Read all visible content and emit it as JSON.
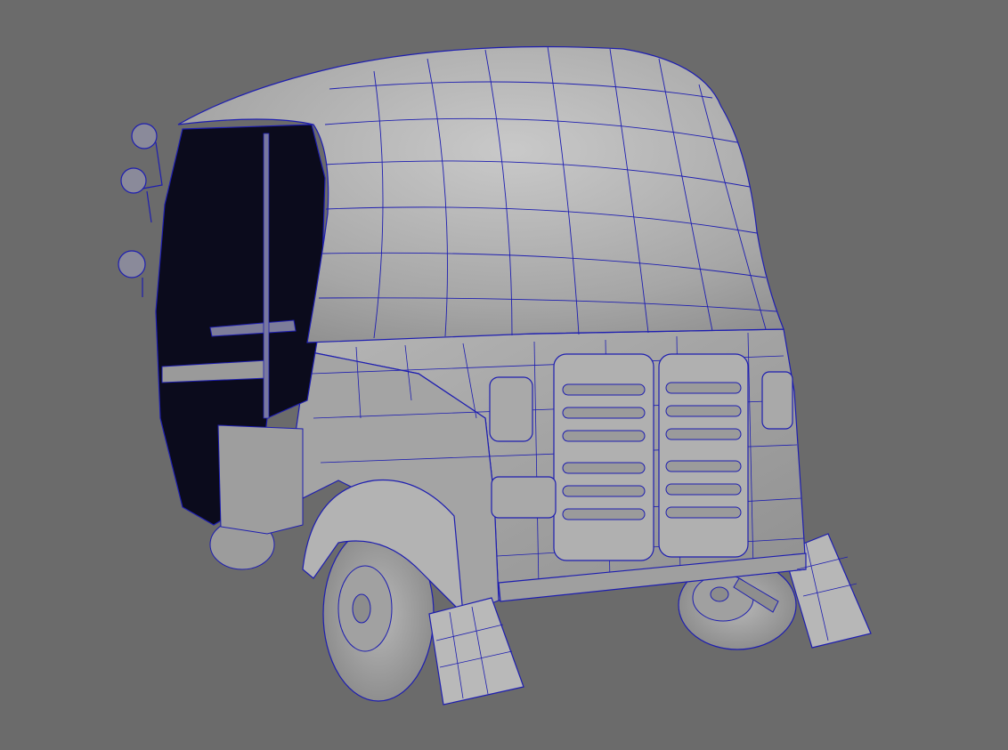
{
  "viewport": {
    "background": "#6b6b6b",
    "shell_color": "#a9a9a9",
    "shell_light": "#c4c4c4",
    "shell_dark": "#8a8a8a",
    "cabin_color": "#0b0b1c",
    "wire_color": "#1e1eb0",
    "tire_color": "#9b9b9b"
  }
}
